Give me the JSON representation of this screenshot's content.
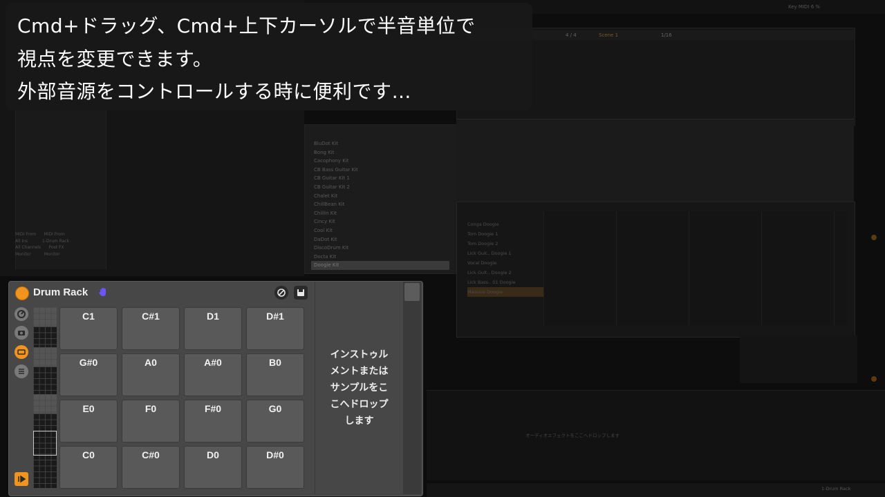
{
  "caption": {
    "line1": "Cmd+ドラッグ、Cmd+上下カーソルで半音単位で",
    "line2": "視点を変更できます。",
    "line3": "外部音源をコントロールする時に便利です…"
  },
  "device": {
    "title": "Drum Rack",
    "pads": [
      [
        "C1",
        "C#1",
        "D1",
        "D#1"
      ],
      [
        "G#0",
        "A0",
        "A#0",
        "B0"
      ],
      [
        "E0",
        "F0",
        "F#0",
        "G0"
      ],
      [
        "C0",
        "C#0",
        "D0",
        "D#0"
      ]
    ],
    "drop_text": [
      "インストゥル",
      "メントまたは",
      "サンプルをこ",
      "こへドロップ",
      "します"
    ]
  },
  "browser": {
    "items": [
      "BluDot Kit",
      "Bong Kit",
      "Cacophony Kit",
      "CB Bass Guitar Kit",
      "CB Guitar Kit 1",
      "CB Guitar Kit 2",
      "Chalet Kit",
      "ChillBean Kit",
      "Chillin Kit",
      "Cincy Kit",
      "Cool Kit",
      "DaDot Kit",
      "DiscoDrum Kit",
      "Docta Kit",
      "Doogie Kit"
    ],
    "selected": "Doogie Kit"
  },
  "midi_rows": [
    "Conga Doogie",
    "Tom Doogie 1",
    "Tom Doogie 2",
    "Lick Guit.. Doogie 1",
    "Vocal Doogie",
    "Lick Guit.. Doogie 2",
    "Lick Bass.. 01 Doogie",
    "Massive Doogie"
  ],
  "session": {
    "meter": "4 / 4",
    "scene": "Scene 1",
    "quant": "1/16"
  },
  "drop_hint": "オーディオエフェクトをここへドロップします",
  "bottom_track": "1-Drum Rack",
  "top_right": "Key  MIDI  6 %"
}
